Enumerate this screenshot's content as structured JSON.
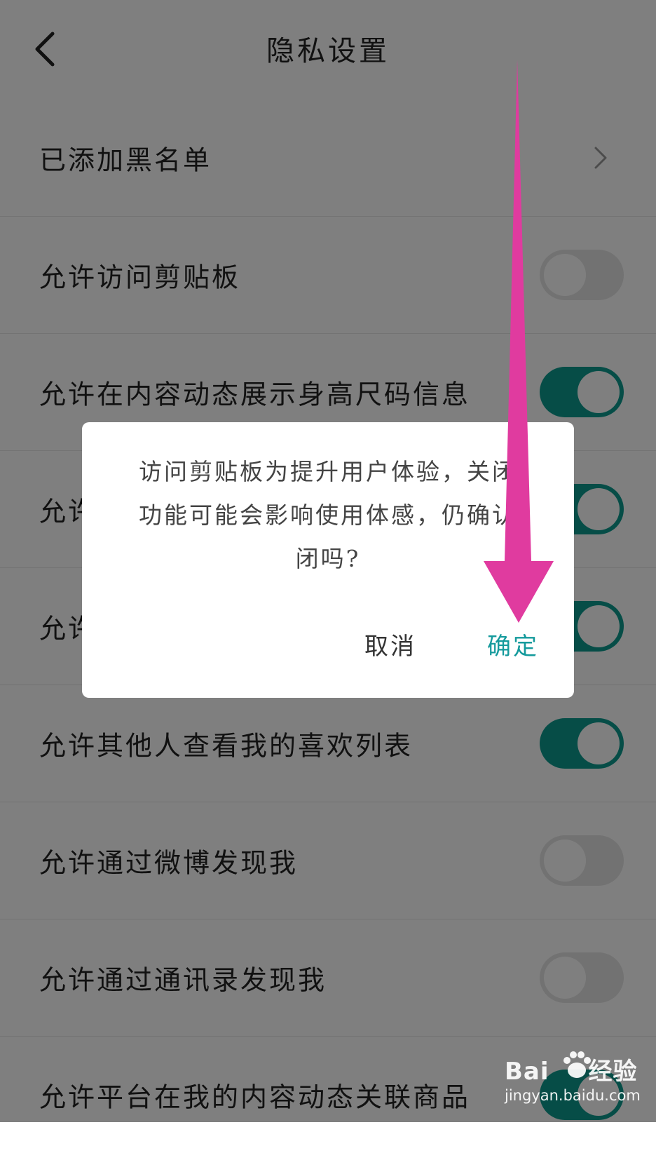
{
  "header": {
    "title": "隐私设置",
    "back_icon": "chevron-left-icon"
  },
  "settings": [
    {
      "label": "已添加黑名单",
      "control": "chevron",
      "icon": "chevron-right-icon"
    },
    {
      "label": "允许访问剪贴板",
      "control": "toggle",
      "state": "off"
    },
    {
      "label": "允许在内容动态展示身高尺码信息",
      "control": "toggle",
      "state": "on"
    },
    {
      "label": "允许",
      "control": "toggle",
      "state": "on"
    },
    {
      "label": "允许",
      "control": "toggle",
      "state": "on"
    },
    {
      "label": "允许其他人查看我的喜欢列表",
      "control": "toggle",
      "state": "on"
    },
    {
      "label": "允许通过微博发现我",
      "control": "toggle",
      "state": "off"
    },
    {
      "label": "允许通过通讯录发现我",
      "control": "toggle",
      "state": "off"
    },
    {
      "label": "允许平台在我的内容动态关联商品",
      "control": "toggle",
      "state": "on"
    }
  ],
  "dialog": {
    "message_line1": "访问剪贴板为提升用户体验，关闭",
    "message_line2": "功能可能会影响使用体感，仍确认",
    "message_line3": "闭吗?",
    "cancel_label": "取消",
    "confirm_label": "确定"
  },
  "annotation": {
    "icon": "down-arrow-annotation",
    "color": "#e03b9f"
  },
  "watermark": {
    "brand_prefix": "Bai",
    "brand_suffix": "经验",
    "site": "jingyan.baidu.com",
    "icon": "paw-icon"
  },
  "colors": {
    "accent": "#0c9a8e",
    "confirm_text": "#149a9c",
    "toggle_off": "#e4e4e4"
  }
}
